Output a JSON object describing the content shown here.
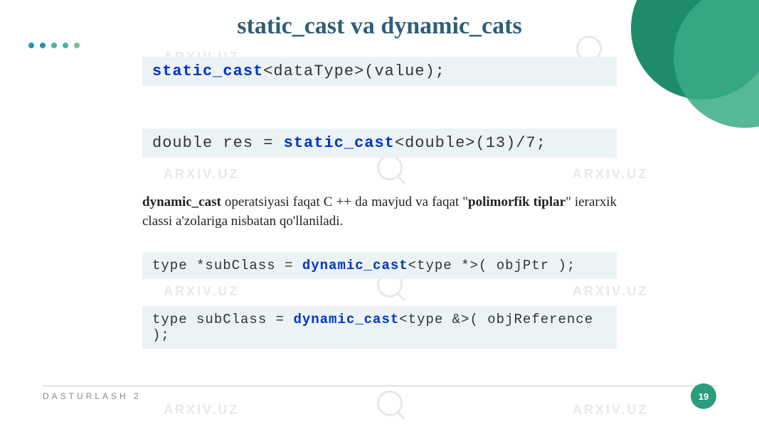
{
  "title": "static_cast va dynamic_cats",
  "code1": {
    "keyword": "static_cast",
    "rest": "<dataType>(value);"
  },
  "code2": {
    "prefix": "double res = ",
    "keyword": "static_cast",
    "rest": "<double>(13)/7;"
  },
  "paragraph": {
    "strong1": "dynamic_cast",
    "text1": " operatsiyasi faqat C ++ da mavjud va faqat \"",
    "strong2": "polimorfik tiplar",
    "text2": "\" ierarxik classi a'zolariga nisbatan qo'llaniladi."
  },
  "code3": {
    "prefix": "type *subClass = ",
    "keyword": "dynamic_cast",
    "rest": "<type *>( objPtr );"
  },
  "code4": {
    "prefix": "type subClass = ",
    "keyword": "dynamic_cast",
    "rest": "<type &>( objReference );"
  },
  "watermark_text": "ARXIV.UZ",
  "footer": {
    "text": "DASTURLASH 2",
    "page": "19"
  }
}
